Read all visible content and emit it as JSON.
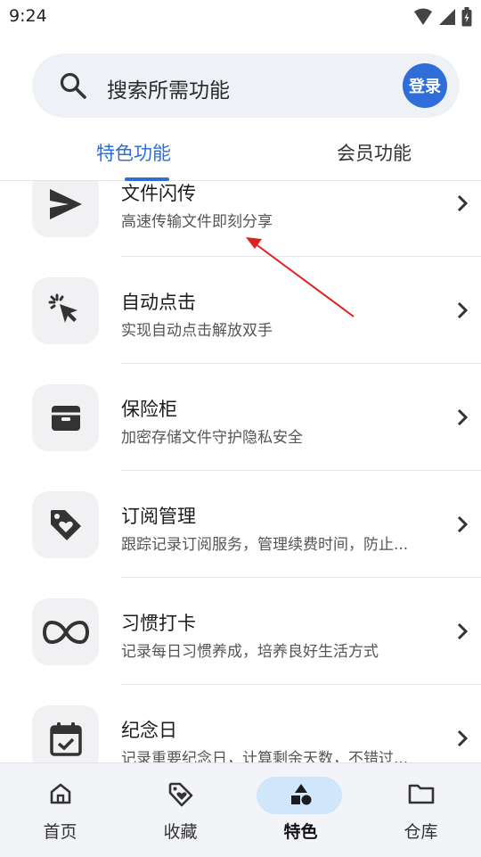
{
  "status_bar": {
    "time": "9:24"
  },
  "search": {
    "placeholder": "搜索所需功能",
    "login_label": "登录"
  },
  "tabs": [
    {
      "label": "特色功能",
      "active": true
    },
    {
      "label": "会员功能",
      "active": false
    }
  ],
  "features": [
    {
      "title": "文件闪传",
      "desc": "高速传输文件即刻分享",
      "icon": "send-icon"
    },
    {
      "title": "自动点击",
      "desc": "实现自动点击解放双手",
      "icon": "auto-click-icon"
    },
    {
      "title": "保险柜",
      "desc": "加密存储文件守护隐私安全",
      "icon": "safe-box-icon"
    },
    {
      "title": "订阅管理",
      "desc": "跟踪记录订阅服务，管理续费时间，防止...",
      "icon": "tag-heart-icon"
    },
    {
      "title": "习惯打卡",
      "desc": "记录每日习惯养成，培养良好生活方式",
      "icon": "infinity-icon"
    },
    {
      "title": "纪念日",
      "desc": "记录重要纪念日，计算剩余天数，不错过...",
      "icon": "calendar-check-icon"
    }
  ],
  "bottom_nav": [
    {
      "label": "首页",
      "icon": "home-icon",
      "active": false
    },
    {
      "label": "收藏",
      "icon": "favorite-tag-icon",
      "active": false
    },
    {
      "label": "特色",
      "icon": "shapes-icon",
      "active": true
    },
    {
      "label": "仓库",
      "icon": "folder-icon",
      "active": false
    }
  ],
  "colors": {
    "accent": "#2f6ed8",
    "active_pill": "#cfe6fb",
    "annotation": "#e02020"
  }
}
